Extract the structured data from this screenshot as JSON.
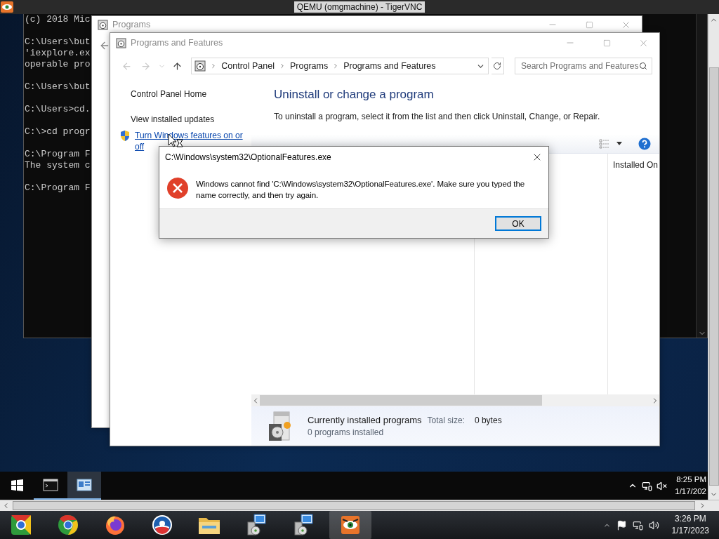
{
  "vnc_window": {
    "title": "QEMU (omgmachine) - TigerVNC"
  },
  "console": {
    "blocks": [
      [
        "(c) 2018 Mic"
      ],
      [
        "C:\\Users\\but",
        "'iexplore.ex",
        "operable pro"
      ],
      [
        "C:\\Users\\but"
      ],
      [
        "C:\\Users>cd."
      ],
      [
        "C:\\>cd progr"
      ],
      [
        "C:\\Program F",
        "The system c"
      ],
      [
        "C:\\Program F"
      ]
    ]
  },
  "programs_window": {
    "title": "Programs"
  },
  "programs_and_features": {
    "title": "Programs and Features",
    "breadcrumbs": [
      "Control Panel",
      "Programs",
      "Programs and Features"
    ],
    "search": {
      "placeholder": "Search Programs and Features"
    },
    "sidebar": {
      "items": [
        {
          "label": "Control Panel Home",
          "kind": "plain"
        },
        {
          "label": "View installed updates",
          "kind": "plain"
        },
        {
          "label": "Turn Windows features on or off",
          "kind": "shield_link"
        }
      ]
    },
    "heading": "Uninstall or change a program",
    "description": "To uninstall a program, select it from the list and then click Uninstall, Change, or Repair.",
    "columns": [
      {
        "label": "Installed On"
      }
    ],
    "details": {
      "title": "Currently installed programs",
      "size_label": "Total size:",
      "size": "0 bytes",
      "count": "0 programs installed"
    }
  },
  "dialog": {
    "title": "C:\\Windows\\system32\\OptionalFeatures.exe",
    "message": "Windows cannot find 'C:\\Windows\\system32\\OptionalFeatures.exe'. Make sure you typed the name correctly, and then try again.",
    "buttons": [
      {
        "label": "OK",
        "focused": true
      }
    ]
  },
  "remote_taskbar": {
    "apps": [
      {
        "kind": "console",
        "selected": false
      },
      {
        "kind": "control_panel",
        "selected": true
      }
    ],
    "time": "8:25 PM",
    "date": "1/17/202"
  },
  "host_taskbar": {
    "apps": [
      {
        "kind": "chromium",
        "selected": false
      },
      {
        "kind": "chrome",
        "selected": false
      },
      {
        "kind": "firefox",
        "selected": false
      },
      {
        "kind": "round_logo",
        "selected": false
      },
      {
        "kind": "folder",
        "selected": false
      },
      {
        "kind": "installer",
        "selected": false
      },
      {
        "kind": "installer",
        "selected": false
      },
      {
        "kind": "vnc",
        "selected": true
      }
    ],
    "time": "3:26 PM",
    "date": "1/17/2023"
  }
}
